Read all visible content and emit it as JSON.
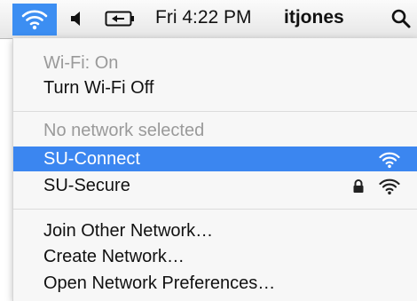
{
  "menubar": {
    "wifi_icon": "wifi-icon",
    "volume_icon": "volume-icon",
    "battery_icon": "battery-icon",
    "clock": "Fri 4:22 PM",
    "user": "itjones",
    "search_icon": "search-icon",
    "accent_color": "#3c8ef2"
  },
  "menu": {
    "status": "Wi-Fi: On",
    "toggle": "Turn Wi-Fi Off",
    "network_header": "No network selected",
    "networks": [
      {
        "name": "SU-Connect",
        "secured": false,
        "selected": true
      },
      {
        "name": "SU-Secure",
        "secured": true,
        "selected": false
      }
    ],
    "join_other": "Join Other Network…",
    "create": "Create Network…",
    "preferences": "Open Network Preferences…",
    "highlight_color": "#3b86f0"
  }
}
